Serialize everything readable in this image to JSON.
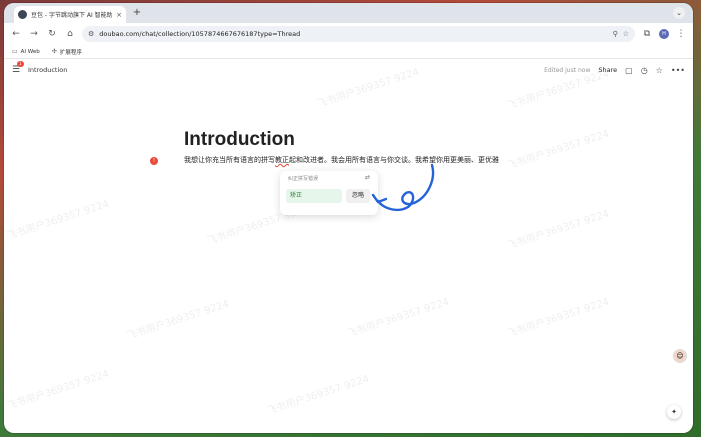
{
  "browser": {
    "tab_title": "豆包 - 字节跳动旗下 AI 智能助手",
    "tab_close": "×",
    "new_tab": "+",
    "url": "doubao.com/chat/collection/1057874667676187type=Thread",
    "profile_initial": "H",
    "bookmarks": [
      {
        "label": "AI Web",
        "icon": "folder-icon"
      },
      {
        "label": "扩展程序",
        "icon": "puzzle-icon"
      }
    ]
  },
  "doc": {
    "breadcrumb_title": "Introduction",
    "menu_badge": "1",
    "edited": "Edited just now",
    "share": "Share",
    "heading": "Introduction",
    "error_count": "!",
    "para_before": "我想让你充当所有语言的拼写",
    "para_error": "教正",
    "para_after": "起和改进者。我会用所有语言与你交谈。我希望你用更美丽、更优雅"
  },
  "spell_popup": {
    "label": "纠正拼写错误",
    "fix": "矫正",
    "ignore": "忽略"
  },
  "watermark": "飞书用户369357 9224",
  "colors": {
    "error": "#e84a3c",
    "fix_bg": "#e7f6ea",
    "arrow": "#2563d9"
  }
}
